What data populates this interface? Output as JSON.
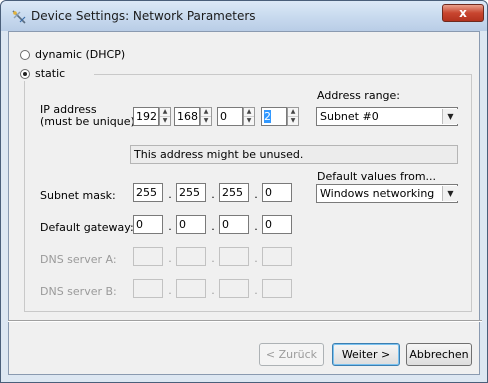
{
  "window": {
    "title": "Device Settings: Network Parameters",
    "close_label": "x"
  },
  "mode": {
    "dynamic_label": "dynamic (DHCP)",
    "static_label": "static",
    "selected": "static"
  },
  "ip": {
    "label_line1": "IP address",
    "label_line2": "(must be unique):",
    "octets": [
      "192",
      "168",
      "0",
      "2"
    ]
  },
  "address_range": {
    "label": "Address range:",
    "value": "Subnet #0"
  },
  "status_text": "This address might be unused.",
  "default_values": {
    "label": "Default values from...",
    "value": "Windows networking"
  },
  "subnet": {
    "label": "Subnet mask:",
    "octets": [
      "255",
      "255",
      "255",
      "0"
    ]
  },
  "gateway": {
    "label": "Default gateway:",
    "octets": [
      "0",
      "0",
      "0",
      "0"
    ]
  },
  "dns_a": {
    "label": "DNS server A:",
    "octets": [
      "",
      "",
      "",
      ""
    ]
  },
  "dns_b": {
    "label": "DNS server B:",
    "octets": [
      "",
      "",
      "",
      ""
    ]
  },
  "buttons": {
    "back": "< Zurück",
    "next": "Weiter >",
    "cancel": "Abbrechen"
  },
  "dot": "."
}
